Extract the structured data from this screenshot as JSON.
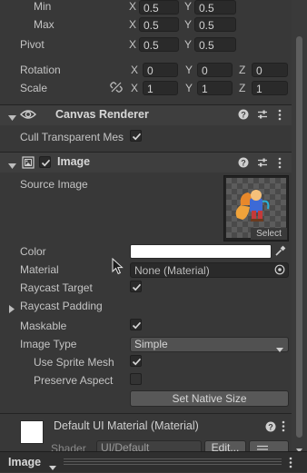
{
  "rect_transform": {
    "min": {
      "label": "Min",
      "x": "0.5",
      "y": "0.5"
    },
    "max": {
      "label": "Max",
      "x": "0.5",
      "y": "0.5"
    },
    "pivot": {
      "label": "Pivot",
      "x": "0.5",
      "y": "0.5"
    },
    "rotation": {
      "label": "Rotation",
      "x": "0",
      "y": "0",
      "z": "0"
    },
    "scale": {
      "label": "Scale",
      "x": "1",
      "y": "1",
      "z": "1"
    },
    "axes": {
      "x": "X",
      "y": "Y",
      "z": "Z"
    }
  },
  "canvas_renderer": {
    "title": "Canvas Renderer",
    "cull_label": "Cull Transparent Mes",
    "cull_checked": true
  },
  "image": {
    "title": "Image",
    "enabled": true,
    "source_image_label": "Source Image",
    "select_label": "Select",
    "color_label": "Color",
    "color_value": "#ffffff",
    "material_label": "Material",
    "material_value": "None (Material)",
    "raycast_target_label": "Raycast Target",
    "raycast_target_checked": true,
    "raycast_padding_label": "Raycast Padding",
    "maskable_label": "Maskable",
    "maskable_checked": true,
    "image_type_label": "Image Type",
    "image_type_value": "Simple",
    "use_sprite_mesh_label": "Use Sprite Mesh",
    "use_sprite_mesh_checked": true,
    "preserve_aspect_label": "Preserve Aspect",
    "preserve_aspect_checked": false,
    "set_native_size_label": "Set Native Size"
  },
  "material_footer": {
    "title": "Default UI Material (Material)",
    "shader_label": "Shader",
    "shader_value": "UI/Default",
    "edit_label": "Edit...",
    "swatch_color": "#ffffff"
  },
  "bottom_bar": {
    "label": "Image"
  },
  "colors": {
    "background": "#383838",
    "header": "#3e3e3e",
    "field": "#2a2a2a",
    "accent_checkbox": "#d8d8d8"
  }
}
